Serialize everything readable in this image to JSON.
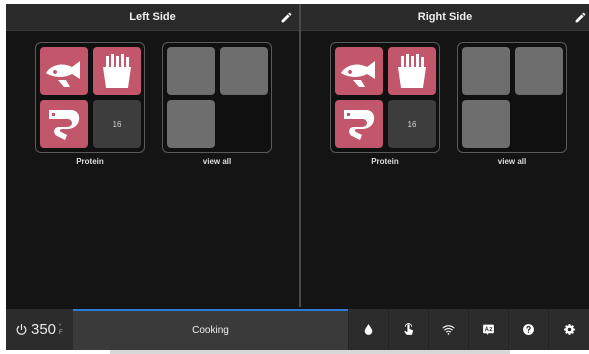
{
  "left_panel": {
    "title": "Left Side",
    "groups": [
      {
        "label": "Protein",
        "badge": "16"
      },
      {
        "label": "view all"
      }
    ]
  },
  "right_panel": {
    "title": "Right Side",
    "groups": [
      {
        "label": "Protein",
        "badge": "16"
      },
      {
        "label": "view all"
      }
    ]
  },
  "footer": {
    "temperature": "350",
    "temperature_unit": "°F",
    "status": "Cooking",
    "icons": [
      "water-drop-icon",
      "touch-icon",
      "wifi-icon",
      "language-icon",
      "help-icon",
      "settings-icon"
    ]
  },
  "colors": {
    "accent": "#2b7bd6",
    "tile_pink": "#c2566b",
    "background": "#141414"
  }
}
